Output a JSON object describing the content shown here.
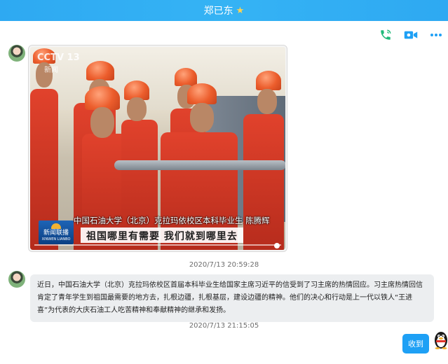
{
  "window": {
    "title": "郑已东",
    "title_badge": "star-icon"
  },
  "toolbar": {
    "icons": [
      "phone-icon",
      "video-call-icon",
      "more-icon"
    ],
    "accent": "#1ea0f5",
    "green": "#20b97a"
  },
  "messages": [
    {
      "type": "image",
      "sender": "contact",
      "video": {
        "channel_logo": "CCTV 13",
        "channel_sub": "新闻",
        "caption_line1": "中国石油大学（北京）克拉玛依校区本科毕业生 陈腾辉",
        "caption_line2": "祖国哪里有需要  我们就到哪里去",
        "program_logo_line1": "新闻联播",
        "program_logo_line2": "XINWEN LIANBO"
      }
    },
    {
      "type": "timestamp",
      "text": "2020/7/13 20:59:28"
    },
    {
      "type": "text",
      "sender": "contact",
      "text": "近日，中国石油大学（北京）克拉玛依校区首届本科毕业生给国家主席习近平的信受到了习主席的热情回应。习主席热情回信肯定了青年学生到祖国最需要的地方去，扎根边疆，扎根基层，建设边疆的精神。他们的决心和行动是上一代以铁人“王进喜”为代表的大庆石油工人吃苦精神和奉献精神的继承和发扬。"
    },
    {
      "type": "timestamp",
      "text": "2020/7/13 21:15:05"
    },
    {
      "type": "text",
      "sender": "self",
      "text": "收到"
    }
  ]
}
